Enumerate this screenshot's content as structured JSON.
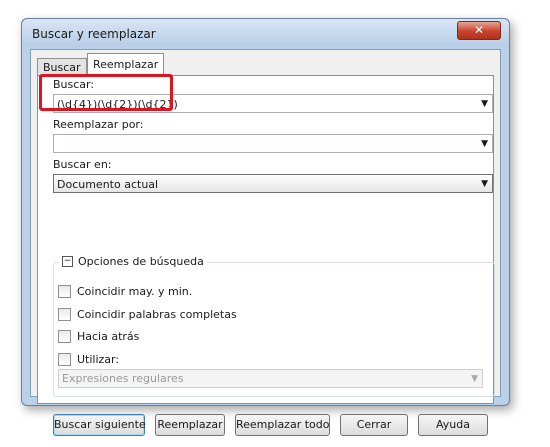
{
  "window": {
    "title": "Buscar y reemplazar",
    "close_glyph": "✕"
  },
  "tabs": [
    {
      "label": "Buscar"
    },
    {
      "label": "Reemplazar"
    }
  ],
  "find": {
    "label": "Buscar:",
    "value": "(\\d{4})(\\d{2})(\\d{2})"
  },
  "replace": {
    "label": "Reemplazar por:",
    "value": ""
  },
  "search_in": {
    "label": "Buscar en:",
    "value": "Documento actual"
  },
  "options": {
    "header": "Opciones de búsqueda",
    "toggle_glyph": "−",
    "checkboxes": [
      {
        "label": "Coincidir may. y min.",
        "checked": false
      },
      {
        "label": "Coincidir palabras completas",
        "checked": false
      },
      {
        "label": "Hacia atrás",
        "checked": false
      },
      {
        "label": "Utilizar:",
        "checked": false
      }
    ],
    "use_value": "Expresiones regulares"
  },
  "buttons": {
    "find_next": "Buscar siguiente",
    "replace": "Reemplazar",
    "replace_all": "Reemplazar todo",
    "close": "Cerrar",
    "help": "Ayuda"
  },
  "icons": {
    "dropdown": "chevron-down-icon",
    "close": "close-icon",
    "collapse": "minus-icon"
  },
  "colors": {
    "highlight": "#e0141e",
    "title_bar": "#c7d9ee",
    "close_button": "#c7432d"
  }
}
